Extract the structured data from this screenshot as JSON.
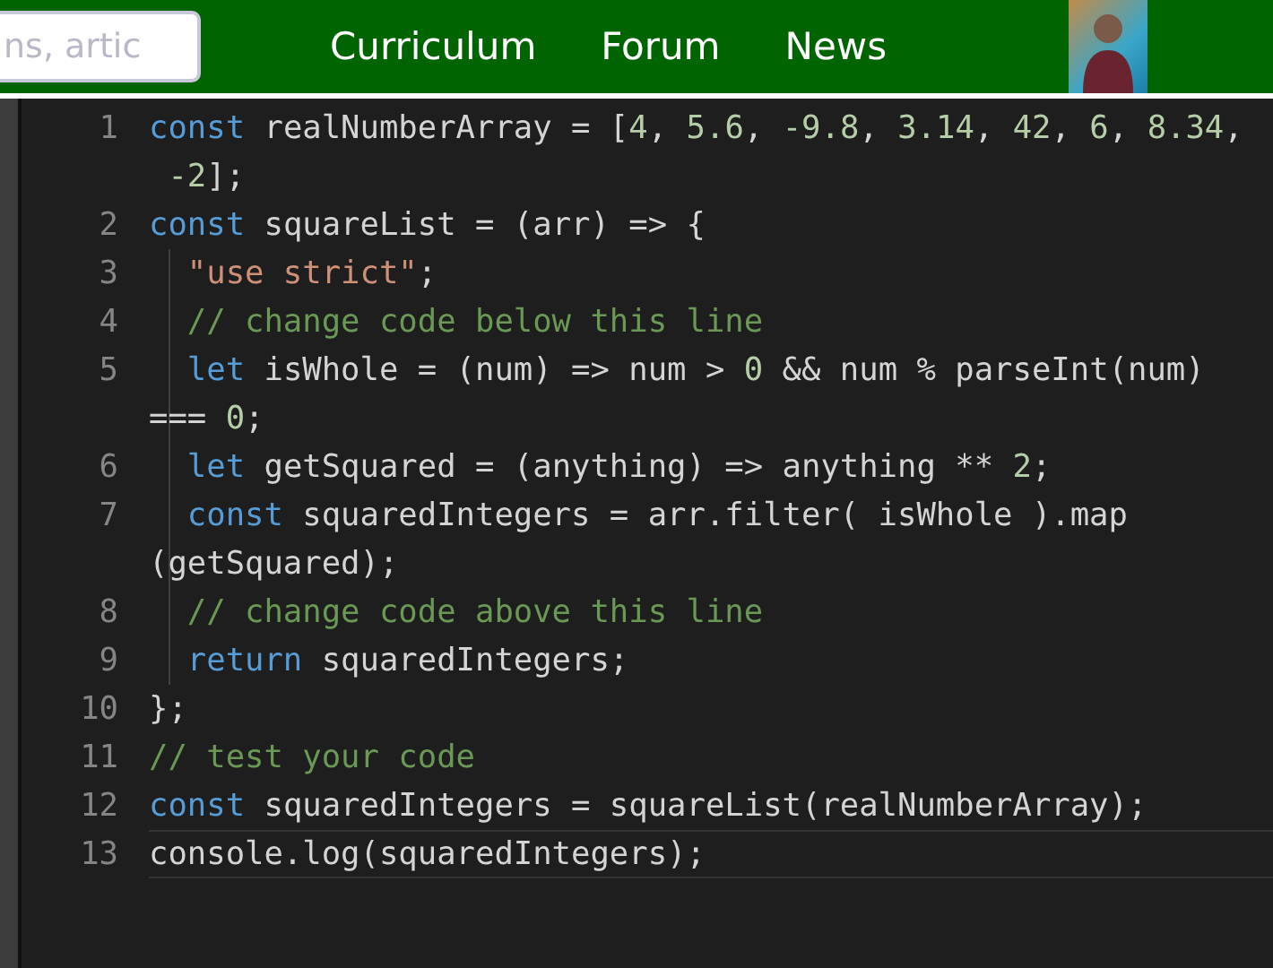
{
  "header": {
    "search": {
      "placeholder": "ns, artic"
    },
    "nav": [
      "Curriculum",
      "Forum",
      "News"
    ]
  },
  "editor": {
    "lines": [
      {
        "number": "1",
        "active": false,
        "rows": [
          {
            "tokens": [
              {
                "kind": "keyword",
                "text": "const"
              },
              {
                "kind": "plain",
                "text": " realNumberArray = ["
              },
              {
                "kind": "number",
                "text": "4"
              },
              {
                "kind": "plain",
                "text": ", "
              },
              {
                "kind": "number",
                "text": "5.6"
              },
              {
                "kind": "plain",
                "text": ", "
              },
              {
                "kind": "number",
                "text": "-9.8"
              },
              {
                "kind": "plain",
                "text": ", "
              },
              {
                "kind": "number",
                "text": "3.14"
              },
              {
                "kind": "plain",
                "text": ", "
              },
              {
                "kind": "number",
                "text": "42"
              },
              {
                "kind": "plain",
                "text": ", "
              },
              {
                "kind": "number",
                "text": "6"
              },
              {
                "kind": "plain",
                "text": ", "
              },
              {
                "kind": "number",
                "text": "8.34"
              },
              {
                "kind": "plain",
                "text": ","
              }
            ]
          },
          {
            "tokens": [
              {
                "kind": "number",
                "text": " -2"
              },
              {
                "kind": "plain",
                "text": "];"
              }
            ]
          }
        ]
      },
      {
        "number": "2",
        "active": false,
        "rows": [
          {
            "tokens": [
              {
                "kind": "keyword",
                "text": "const"
              },
              {
                "kind": "plain",
                "text": " squareList = (arr) => {"
              }
            ]
          }
        ],
        "children": [
          {
            "number": "3",
            "active": false,
            "rows": [
              {
                "tokens": [
                  {
                    "kind": "string",
                    "text": "\"use strict\""
                  },
                  {
                    "kind": "plain",
                    "text": ";"
                  }
                ]
              }
            ]
          },
          {
            "number": "4",
            "active": false,
            "rows": [
              {
                "tokens": [
                  {
                    "kind": "comment",
                    "text": "// change code below this line"
                  }
                ]
              }
            ]
          },
          {
            "number": "5",
            "active": false,
            "rows": [
              {
                "tokens": [
                  {
                    "kind": "keyword",
                    "text": "let"
                  },
                  {
                    "kind": "plain",
                    "text": " isWhole = (num) => num > "
                  },
                  {
                    "kind": "number",
                    "text": "0"
                  },
                  {
                    "kind": "plain",
                    "text": " && num % parseInt(num)"
                  }
                ]
              },
              {
                "tokens": [
                  {
                    "kind": "plain",
                    "text": "=== "
                  },
                  {
                    "kind": "number",
                    "text": "0"
                  },
                  {
                    "kind": "plain",
                    "text": ";"
                  }
                ]
              }
            ]
          },
          {
            "number": "6",
            "active": false,
            "rows": [
              {
                "tokens": [
                  {
                    "kind": "keyword",
                    "text": "let"
                  },
                  {
                    "kind": "plain",
                    "text": " getSquared = (anything) => anything ** "
                  },
                  {
                    "kind": "number",
                    "text": "2"
                  },
                  {
                    "kind": "plain",
                    "text": ";"
                  }
                ]
              }
            ]
          },
          {
            "number": "7",
            "active": false,
            "rows": [
              {
                "tokens": [
                  {
                    "kind": "keyword",
                    "text": "const"
                  },
                  {
                    "kind": "plain",
                    "text": " squaredIntegers = arr.filter( isWhole ).map"
                  }
                ]
              },
              {
                "tokens": [
                  {
                    "kind": "plain",
                    "text": "(getSquared);"
                  }
                ]
              }
            ]
          },
          {
            "number": "8",
            "active": false,
            "rows": [
              {
                "tokens": [
                  {
                    "kind": "comment",
                    "text": "// change code above this line"
                  }
                ]
              }
            ]
          },
          {
            "number": "9",
            "active": false,
            "rows": [
              {
                "tokens": [
                  {
                    "kind": "keyword",
                    "text": "return"
                  },
                  {
                    "kind": "plain",
                    "text": " squaredIntegers;"
                  }
                ]
              }
            ]
          }
        ]
      },
      {
        "number": "10",
        "active": false,
        "rows": [
          {
            "tokens": [
              {
                "kind": "plain",
                "text": "};"
              }
            ]
          }
        ]
      },
      {
        "number": "11",
        "active": false,
        "rows": [
          {
            "tokens": [
              {
                "kind": "comment",
                "text": "// test your code"
              }
            ]
          }
        ]
      },
      {
        "number": "12",
        "active": false,
        "rows": [
          {
            "tokens": [
              {
                "kind": "keyword",
                "text": "const"
              },
              {
                "kind": "plain",
                "text": " squaredIntegers = squareList(realNumberArray);"
              }
            ]
          }
        ]
      },
      {
        "number": "13",
        "active": true,
        "rows": [
          {
            "tokens": [
              {
                "kind": "plain",
                "text": "console.log(squaredIntegers);"
              }
            ]
          }
        ]
      }
    ]
  }
}
